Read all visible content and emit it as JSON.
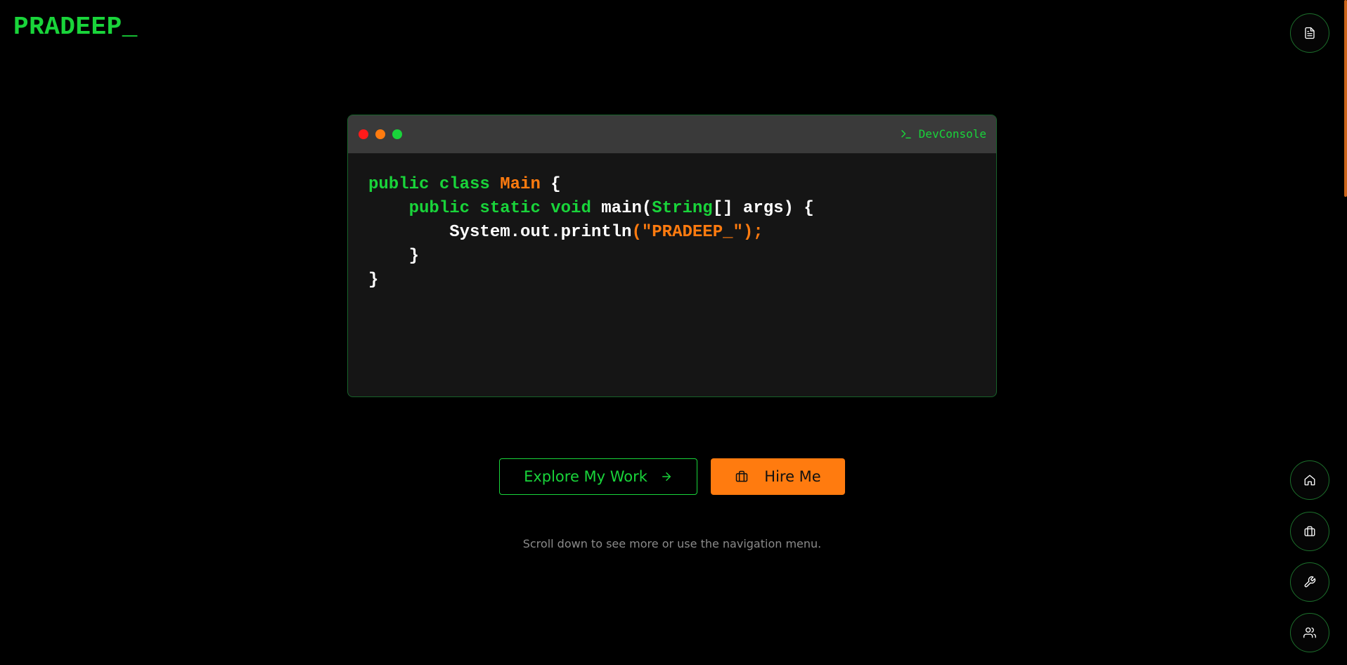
{
  "header": {
    "logo": "PRADEEP_"
  },
  "console": {
    "title": "DevConsole",
    "code": {
      "line1_kw": "public class ",
      "line1_cls": "Main",
      "line1_rest": " {",
      "line2_indent": "    ",
      "line2_kw": "public static void ",
      "line2_mid": "main(",
      "line2_type": "String",
      "line2_rest": "[] args) {",
      "line3_indent": "        ",
      "line3_code": "System.out.println",
      "line3_str": "(\"PRADEEP_\");",
      "line4": "    }",
      "line5": "}"
    }
  },
  "actions": {
    "explore_label": "Explore My Work",
    "hire_label": "Hire Me"
  },
  "hint": "Scroll down to see more or use the navigation menu.",
  "colors": {
    "accent_green": "#19d43a",
    "accent_orange": "#ff7b0f",
    "background": "#000000"
  },
  "icons": {
    "resume": "document-icon",
    "home": "home-icon",
    "work": "briefcase-icon",
    "skills": "wrench-icon",
    "contact": "users-icon"
  }
}
